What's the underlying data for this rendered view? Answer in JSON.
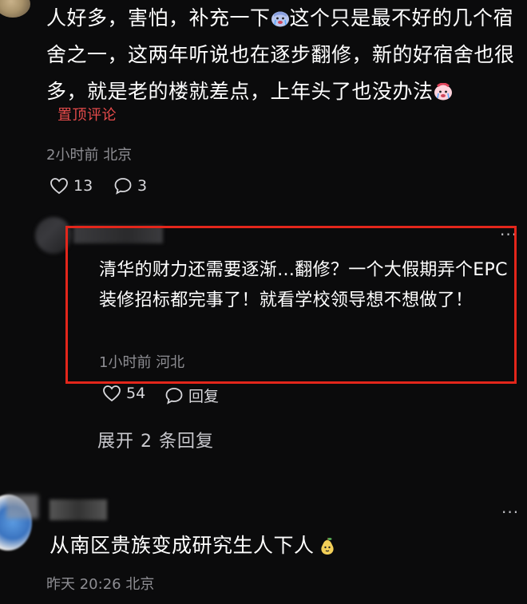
{
  "comment1": {
    "text_part1": "人好多，害怕，补充一下",
    "text_part2": "这个只是最不好的几个宿舍之一，这两年听说也在逐步翻修，新的好宿舍也很多，就是老的楼就差点，上年头了也没办法",
    "emoji_1": "crying-face-emoji",
    "emoji_2": "crying-face-emoji",
    "pinned_label": "置顶评论",
    "time": "2小时前",
    "location": "北京",
    "likes": "13",
    "replies": "3"
  },
  "reply": {
    "text": "清华的财力还需要逐渐…翻修？一个大假期弄个EPC装修招标都完事了！就看学校领导想不想做了！",
    "time": "1小时前",
    "location": "河北",
    "likes": "54",
    "reply_label": "回复",
    "more": "···"
  },
  "expand_label": "展开 2 条回复",
  "comment3": {
    "text": "从南区贵族变成研究生人下人",
    "emoji": "pear-face-emoji",
    "time": "昨天 20:26",
    "location": "北京",
    "more": "···"
  },
  "colors": {
    "background": "#0b0b0c",
    "pinned": "#e64b4b",
    "highlight_border": "#e3261b",
    "meta": "#8e8e93"
  }
}
